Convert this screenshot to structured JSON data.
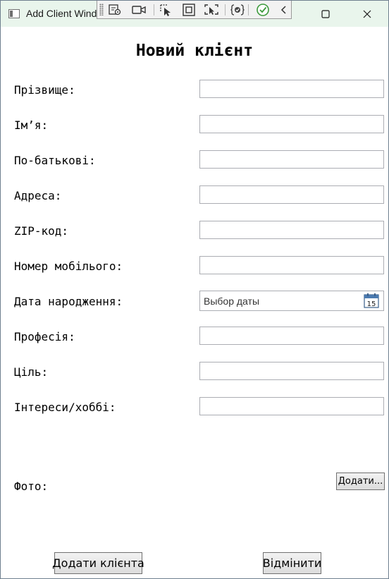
{
  "window": {
    "title": "Add Client Window"
  },
  "page": {
    "heading": "Новий клієнт"
  },
  "form": {
    "fields": [
      {
        "label": "Прізвище:",
        "value": ""
      },
      {
        "label": "Ім’я:",
        "value": ""
      },
      {
        "label": "По-батькові:",
        "value": ""
      },
      {
        "label": "Адреса:",
        "value": ""
      },
      {
        "label": "ZIP-код:",
        "value": ""
      },
      {
        "label": "Номер мобілього:",
        "value": ""
      },
      {
        "label": "Дата народження:",
        "placeholder": "Выбор даты",
        "calendar_day": "15"
      },
      {
        "label": "Професія:",
        "value": ""
      },
      {
        "label": "Ціль:",
        "value": ""
      },
      {
        "label": "Інтереси/хоббі:",
        "value": ""
      }
    ],
    "photo_label": "Фото:",
    "photo_button": "Додати..."
  },
  "footer": {
    "add_button": "Додати клієнта",
    "cancel_button": "Відмінити"
  },
  "colors": {
    "titlebar": "#e9f5ec",
    "field_border": "#abadb3",
    "button_border": "#707070"
  }
}
